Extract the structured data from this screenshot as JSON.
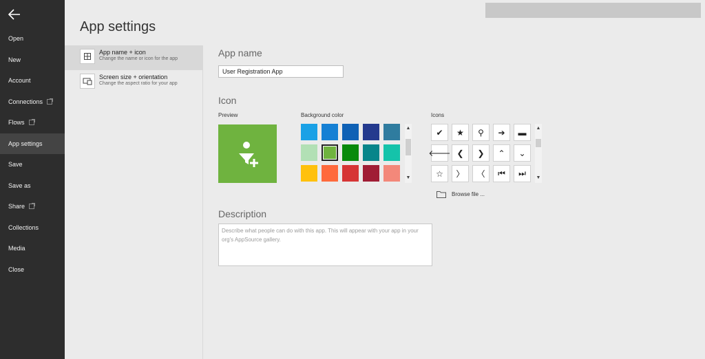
{
  "nav": {
    "items": [
      {
        "label": "Open",
        "external": false,
        "active": false
      },
      {
        "label": "New",
        "external": false,
        "active": false
      },
      {
        "label": "Account",
        "external": false,
        "active": false
      },
      {
        "label": "Connections",
        "external": true,
        "active": false
      },
      {
        "label": "Flows",
        "external": true,
        "active": false
      },
      {
        "label": "App settings",
        "external": false,
        "active": true
      },
      {
        "label": "Save",
        "external": false,
        "active": false
      },
      {
        "label": "Save as",
        "external": false,
        "active": false
      },
      {
        "label": "Share",
        "external": true,
        "active": false
      },
      {
        "label": "Collections",
        "external": false,
        "active": false
      },
      {
        "label": "Media",
        "external": false,
        "active": false
      },
      {
        "label": "Close",
        "external": false,
        "active": false
      }
    ]
  },
  "page": {
    "title": "App settings"
  },
  "categories": [
    {
      "title": "App name + icon",
      "subtitle": "Change the name or icon for the app",
      "icon": "grid-icon"
    },
    {
      "title": "Screen size + orientation",
      "subtitle": "Change the aspect ratio for your app",
      "icon": "screen-icon"
    }
  ],
  "app_name": {
    "heading": "App name",
    "value": "User Registration App"
  },
  "icon_section": {
    "heading": "Icon",
    "preview_label": "Preview",
    "background_label": "Background color",
    "icons_label": "Icons",
    "browse_label": "Browse file ...",
    "preview_color": "#6fb33f",
    "colors": [
      "#1aa1e6",
      "#1580d4",
      "#0f61b5",
      "#243a8e",
      "#2f7c9f",
      "#b2e0b5",
      "#6fb33f",
      "#088a0b",
      "#07858a",
      "#15c3aa",
      "#ffc10d",
      "#ff6a3c",
      "#d63535",
      "#a01d35",
      "#f3887a"
    ],
    "selected_color_index": 6,
    "icons": [
      "check-icon",
      "star-icon",
      "search-icon",
      "arrow-right-icon",
      "minus-icon",
      "arrow-left-icon",
      "chevron-left-icon",
      "chevron-right-icon",
      "chevron-up-icon",
      "chevron-down-icon",
      "star-outline-icon",
      "chevron-right-thin-icon",
      "chevron-left-thin-icon",
      "skip-first-icon",
      "skip-last-icon"
    ],
    "icon_glyphs": [
      "✔",
      "★",
      "⚲",
      "➔",
      "▬",
      "🡐",
      "❮",
      "❯",
      "⌃",
      "⌄",
      "☆",
      "〉",
      "〈",
      "⏮",
      "⏭"
    ]
  },
  "description": {
    "heading": "Description",
    "placeholder": "Describe what people can do with this app. This will appear with your app in your org's AppSource gallery."
  }
}
